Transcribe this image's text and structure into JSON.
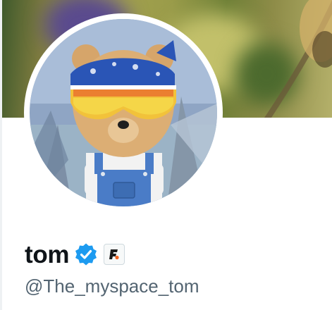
{
  "profile": {
    "display_name": "tom",
    "handle": "@The_myspace_tom",
    "verified": true,
    "verified_icon": "verified-badge-icon",
    "affiliate_icon": "affiliate-badge-icon",
    "avatar_icon": "bear-avatar"
  },
  "colors": {
    "verified": "#1d9bf0",
    "name": "#0f1419",
    "handle": "#536471"
  }
}
